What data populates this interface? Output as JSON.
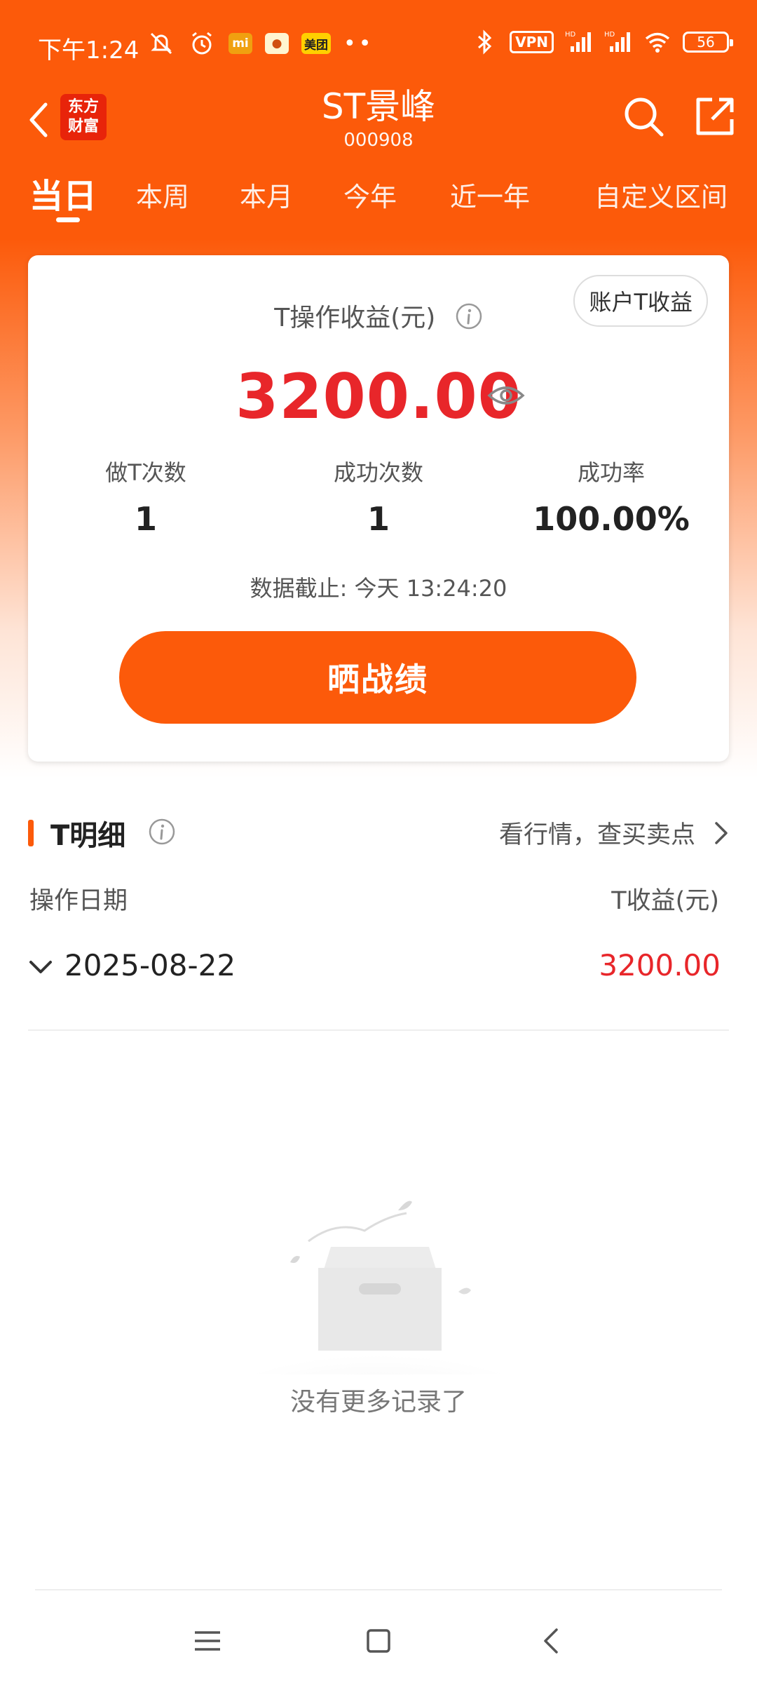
{
  "status_bar": {
    "time": "下午1:24",
    "vpn": "VPN",
    "battery": "56",
    "icons": [
      "mute-icon",
      "alarm-icon",
      "mi-icon",
      "app-icon",
      "meituan-icon",
      "more-dots",
      "bluetooth-icon",
      "signal-hd-icon",
      "signal-hd-icon",
      "wifi-icon",
      "battery-icon"
    ],
    "badges": {
      "mi": "mi",
      "meituan": "美团"
    }
  },
  "header": {
    "logo_line1": "东方",
    "logo_line2": "财富",
    "stock_name": "ST景峰",
    "stock_code": "000908",
    "icons": [
      "back-icon",
      "search-icon",
      "share-icon"
    ]
  },
  "tabs": [
    {
      "label": "当日",
      "active": true
    },
    {
      "label": "本周"
    },
    {
      "label": "本月"
    },
    {
      "label": "今年"
    },
    {
      "label": "近一年"
    },
    {
      "label": "自定义区间"
    }
  ],
  "card": {
    "account_button": "账户T收益",
    "profit_label": "T操作收益(元)",
    "profit_value": "3200.00",
    "stats": [
      {
        "label": "做T次数",
        "value": "1"
      },
      {
        "label": "成功次数",
        "value": "1"
      },
      {
        "label": "成功率",
        "value": "100.00%"
      }
    ],
    "cutoff": "数据截止: 今天 13:24:20",
    "share_button": "晒战绩"
  },
  "detail": {
    "title": "T明细",
    "market_link": "看行情，查买卖点",
    "col_date": "操作日期",
    "col_profit": "T收益(元)",
    "rows": [
      {
        "date": "2025-08-22",
        "profit": "3200.00"
      }
    ],
    "empty_text": "没有更多记录了"
  },
  "colors": {
    "brand_orange": "#fc5a0a",
    "profit_red": "#e8262a"
  }
}
